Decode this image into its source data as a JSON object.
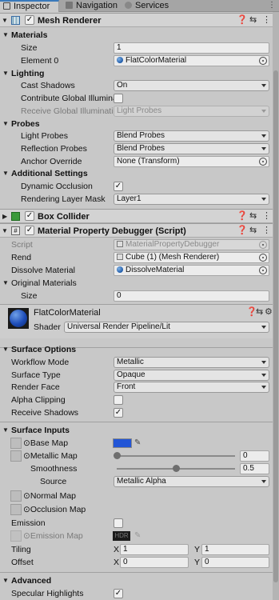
{
  "tabs": [
    {
      "label": "Inspector",
      "active": true
    },
    {
      "label": "Navigation",
      "active": false
    },
    {
      "label": "Services",
      "active": false
    }
  ],
  "mesh_renderer": {
    "title": "Mesh Renderer",
    "materials": {
      "header": "Materials",
      "size_label": "Size",
      "size": "1",
      "element0_label": "Element 0",
      "element0": "FlatColorMaterial"
    },
    "lighting": {
      "header": "Lighting",
      "cast_shadows_label": "Cast Shadows",
      "cast_shadows": "On",
      "contribute_gi_label": "Contribute Global Illuminati",
      "receive_gi_label": "Receive Global Illuminatio",
      "receive_gi": "Light Probes"
    },
    "probes": {
      "header": "Probes",
      "light_probes_label": "Light Probes",
      "light_probes": "Blend Probes",
      "reflection_probes_label": "Reflection Probes",
      "reflection_probes": "Blend Probes",
      "anchor_override_label": "Anchor Override",
      "anchor_override": "None (Transform)"
    },
    "additional": {
      "header": "Additional Settings",
      "dynamic_occlusion_label": "Dynamic Occlusion",
      "rendering_layer_mask_label": "Rendering Layer Mask",
      "rendering_layer_mask": "Layer1"
    }
  },
  "box_collider": {
    "title": "Box Collider"
  },
  "debugger": {
    "title": "Material Property Debugger (Script)",
    "script_label": "Script",
    "script": "MaterialPropertyDebugger",
    "rend_label": "Rend",
    "rend": "Cube (1) (Mesh Renderer)",
    "dissolve_label": "Dissolve Material",
    "dissolve": "DissolveMaterial",
    "original_label": "Original Materials",
    "size_label": "Size",
    "size": "0"
  },
  "material": {
    "name": "FlatColorMaterial",
    "shader_label": "Shader",
    "shader": "Universal Render Pipeline/Lit"
  },
  "surface_options": {
    "header": "Surface Options",
    "workflow_label": "Workflow Mode",
    "workflow": "Metallic",
    "surface_type_label": "Surface Type",
    "surface_type": "Opaque",
    "render_face_label": "Render Face",
    "render_face": "Front",
    "alpha_clip_label": "Alpha Clipping",
    "receive_shadows_label": "Receive Shadows"
  },
  "surface_inputs": {
    "header": "Surface Inputs",
    "base_map_label": "Base Map",
    "base_color": "#2255d6",
    "metallic_label": "Metallic Map",
    "metallic": "0",
    "metallic_level": 0,
    "smoothness_label": "Smoothness",
    "smoothness": "0.5",
    "smoothness_level": 0.5,
    "source_label": "Source",
    "source": "Metallic Alpha",
    "normal_label": "Normal Map",
    "occlusion_label": "Occlusion Map",
    "emission_label": "Emission",
    "emission_map_label": "Emission Map",
    "hdr": "HDR",
    "tiling_label": "Tiling",
    "offset_label": "Offset",
    "x_label": "X",
    "y_label": "Y",
    "tiling_x": "1",
    "tiling_y": "1",
    "offset_x": "0",
    "offset_y": "0"
  },
  "advanced": {
    "header": "Advanced",
    "specular_label": "Specular Highlights"
  },
  "check": "✓"
}
